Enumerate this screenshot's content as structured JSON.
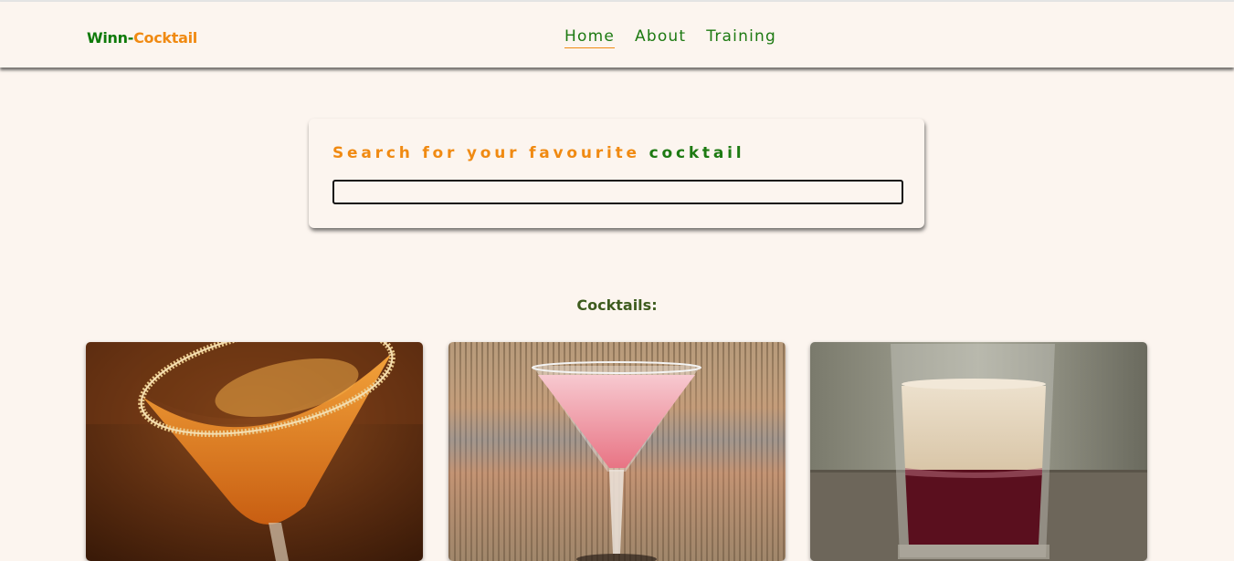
{
  "brand": {
    "part1": "Winn-",
    "part2": "Cocktail"
  },
  "nav": {
    "items": [
      {
        "label": "Home",
        "active": true
      },
      {
        "label": "About",
        "active": false
      },
      {
        "label": "Training",
        "active": false
      }
    ]
  },
  "search": {
    "title_part1": "Search for your favourite ",
    "title_part2": "cocktail",
    "value": "",
    "placeholder": ""
  },
  "cocktails_heading": "Cocktails:",
  "cards": [
    {
      "image": "orange-martini-sugar-rim"
    },
    {
      "image": "pink-martini"
    },
    {
      "image": "layered-shot-glass"
    }
  ],
  "colors": {
    "accent_green": "#1d7a12",
    "accent_orange": "#f08a12",
    "background": "#fcf5ef"
  }
}
